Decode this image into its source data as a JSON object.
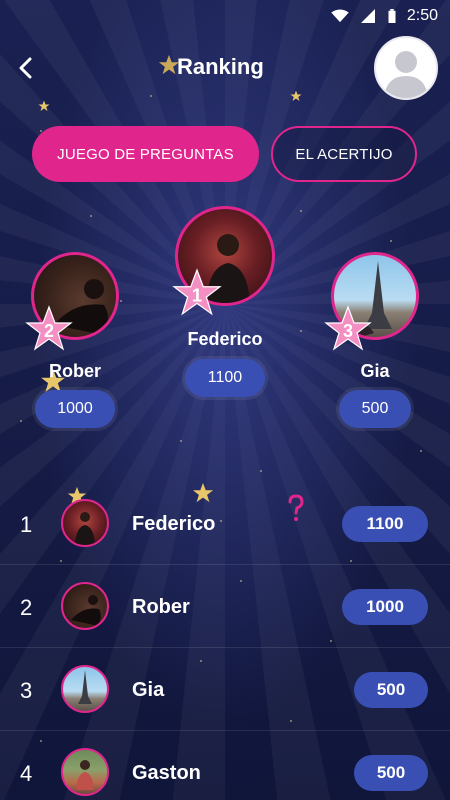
{
  "status_bar": {
    "time": "2:50"
  },
  "header": {
    "title": "Ranking"
  },
  "tabs": [
    {
      "label": "JUEGO DE PREGUNTAS",
      "active": true
    },
    {
      "label": "EL ACERTIJO",
      "active": false
    }
  ],
  "podium": {
    "first": {
      "rank": "1",
      "name": "Federico",
      "score": "1100"
    },
    "second": {
      "rank": "2",
      "name": "Rober",
      "score": "1000"
    },
    "third": {
      "rank": "3",
      "name": "Gia",
      "score": "500"
    }
  },
  "ranking": [
    {
      "rank": "1",
      "name": "Federico",
      "score": "1100"
    },
    {
      "rank": "2",
      "name": "Rober",
      "score": "1000"
    },
    {
      "rank": "3",
      "name": "Gia",
      "score": "500"
    },
    {
      "rank": "4",
      "name": "Gaston",
      "score": "500"
    }
  ],
  "colors": {
    "accent": "#e0268d",
    "score_pill": "#3a4fb4",
    "background": "#161c47",
    "star_pink": "#f48fc3",
    "star_gold": "#e8c66a"
  },
  "icons": [
    "wifi-icon",
    "signal-icon",
    "battery-icon",
    "back-arrow-icon",
    "profile-avatar-icon",
    "star-icon",
    "question-mark-icon"
  ]
}
